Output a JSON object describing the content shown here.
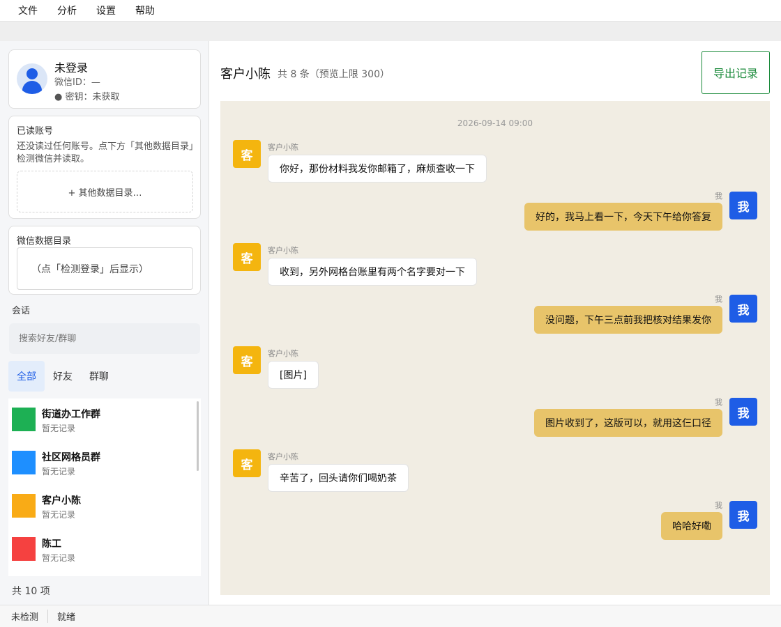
{
  "menu": [
    "文件",
    "分析",
    "设置",
    "帮助"
  ],
  "user": {
    "name": "未登录",
    "id_text": "微信ID：—",
    "key_text": "● 密钥：未获取"
  },
  "read_accounts": {
    "title": "已读账号",
    "desc": "还没读过任何账号。点下方「其他数据目录」检测微信并读取。",
    "button": "+ 其他数据目录…"
  },
  "wechat_dir": {
    "title": "微信数据目录",
    "placeholder": "（点「检测登录」后显示）"
  },
  "sessions": {
    "label": "会话",
    "search_placeholder": "搜索好友/群聊",
    "tabs": [
      "全部",
      "好友",
      "群聊"
    ],
    "items": [
      {
        "name": "街道办工作群",
        "sub": "暂无记录",
        "color": "#1db054"
      },
      {
        "name": "社区网格员群",
        "sub": "暂无记录",
        "color": "#1e8fff"
      },
      {
        "name": "客户小陈",
        "sub": "暂无记录",
        "color": "#f9ab16"
      },
      {
        "name": "陈工",
        "sub": "暂无记录",
        "color": "#f54140"
      }
    ],
    "total": "共 10 项"
  },
  "chat": {
    "title": "客户小陈",
    "count": "共 8 条（预览上限 300）",
    "export_label": "导出记录",
    "timestamp": "2026-09-14 09:00",
    "messages": [
      {
        "from": "them",
        "sender": "客户小陈",
        "avatar": "客",
        "text": "你好，那份材料我发你邮箱了，麻烦查收一下"
      },
      {
        "from": "me",
        "sender": "我",
        "avatar": "我",
        "text": "好的，我马上看一下，今天下午给你答复"
      },
      {
        "from": "them",
        "sender": "客户小陈",
        "avatar": "客",
        "text": "收到，另外网格台账里有两个名字要对一下"
      },
      {
        "from": "me",
        "sender": "我",
        "avatar": "我",
        "text": "没问题，下午三点前我把核对结果发你"
      },
      {
        "from": "them",
        "sender": "客户小陈",
        "avatar": "客",
        "text": "[图片]"
      },
      {
        "from": "me",
        "sender": "我",
        "avatar": "我",
        "text": "图片收到了，这版可以，就用这仨口径"
      },
      {
        "from": "them",
        "sender": "客户小陈",
        "avatar": "客",
        "text": "辛苦了，回头请你们喝奶茶"
      },
      {
        "from": "me",
        "sender": "我",
        "avatar": "我",
        "text": "哈哈好嘞"
      }
    ]
  },
  "status": {
    "detect": "未检测",
    "state": "就绪"
  },
  "colors": {
    "accent": "#1e5de6",
    "export": "#1a8a3a",
    "bubble_me": "#e8c46a",
    "avatar_them": "#f4b50f",
    "chat_bg": "#f1ede3"
  }
}
